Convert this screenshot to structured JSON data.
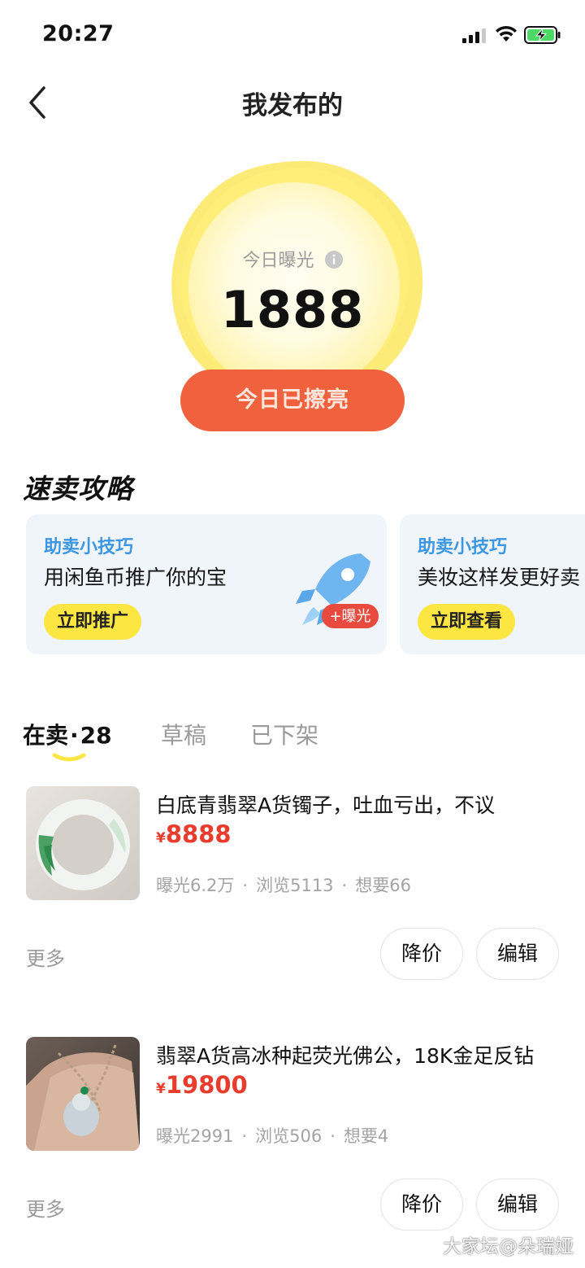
{
  "status_bar": {
    "time": "20:27"
  },
  "header": {
    "title": "我发布的"
  },
  "exposure": {
    "label": "今日曝光",
    "value": "1888",
    "button_label": "今日已擦亮"
  },
  "tips": {
    "section_title": "速卖攻略",
    "cards": [
      {
        "tag": "助卖小技巧",
        "text": "用闲鱼币推广你的宝",
        "button": "立即推广",
        "badge": "+曝光"
      },
      {
        "tag": "助卖小技巧",
        "text": "美妆这样发更好卖",
        "button": "立即查看"
      }
    ]
  },
  "tabs": {
    "on_sale": "在卖",
    "on_sale_dot": "·",
    "on_sale_count": "28",
    "drafts": "草稿",
    "off_shelf": "已下架"
  },
  "listings": [
    {
      "title": "白底青翡翠A货镯子，吐血亏出，不议",
      "price_symbol": "¥",
      "price": "8888",
      "exposure": "曝光6.2万",
      "views": "浏览5113",
      "wants": "想要66",
      "more": "更多",
      "reduce_label": "降价",
      "edit_label": "编辑"
    },
    {
      "title": "翡翠A货高冰种起荧光佛公，18K金足反钻",
      "price_symbol": "¥",
      "price": "19800",
      "exposure": "曝光2991",
      "views": "浏览506",
      "wants": "想要4",
      "more": "更多",
      "reduce_label": "降价",
      "edit_label": "编辑"
    }
  ],
  "stats_separator": "·",
  "watermark": "大家坛@朵瑞娅",
  "colors": {
    "accent_orange": "#f0623d",
    "price_red": "#e93c2d",
    "tip_blue": "#3d97e0",
    "brand_yellow": "#fde542"
  }
}
